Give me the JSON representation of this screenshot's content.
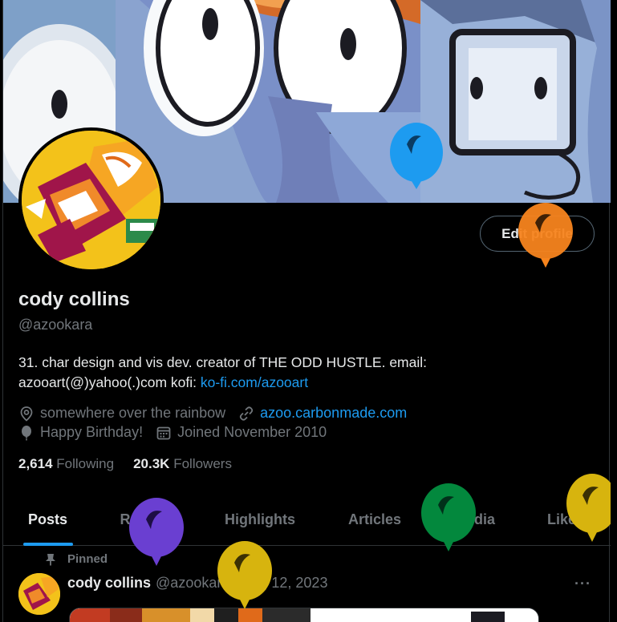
{
  "profile": {
    "name": "cody collins",
    "handle": "@azookara",
    "edit_label": "Edit profile",
    "bio_text": "31. char design and vis dev. creator of THE ODD HUSTLE. email: azooart(@)yahoo(.)com kofi: ",
    "bio_link": "ko-fi.com/azooart",
    "location": "somewhere over the rainbow",
    "website": "azoo.carbonmade.com",
    "birthday": "Happy Birthday!",
    "joined": "Joined November 2010",
    "following_count": "2,614",
    "following_label": "Following",
    "followers_count": "20.3K",
    "followers_label": "Followers"
  },
  "tabs": [
    {
      "label": "Posts",
      "active": true
    },
    {
      "label": "Replies",
      "active": false
    },
    {
      "label": "Highlights",
      "active": false
    },
    {
      "label": "Articles",
      "active": false
    },
    {
      "label": "Media",
      "active": false
    },
    {
      "label": "Likes",
      "active": false
    }
  ],
  "pinned": {
    "label": "Pinned",
    "author": "cody collins",
    "meta": "@azookara · Aug 12, 2023",
    "more": "···"
  },
  "icons": {
    "location": "location-pin-icon",
    "link": "link-icon",
    "birthday": "balloon-icon",
    "joined": "calendar-icon",
    "pin": "pin-icon",
    "more": "more-options-icon"
  },
  "colors": {
    "accent": "#1d9bf0",
    "background": "#000000",
    "muted_text": "#71767b",
    "primary_text": "#e7e9ea",
    "avatar_bg": "#f3c21a",
    "balloon_blue": "#1d9bf0",
    "balloon_orange": "#f7841d",
    "balloon_purple": "#6a3fd1",
    "balloon_yellow": "#d7b40e",
    "balloon_green": "#03883d"
  }
}
